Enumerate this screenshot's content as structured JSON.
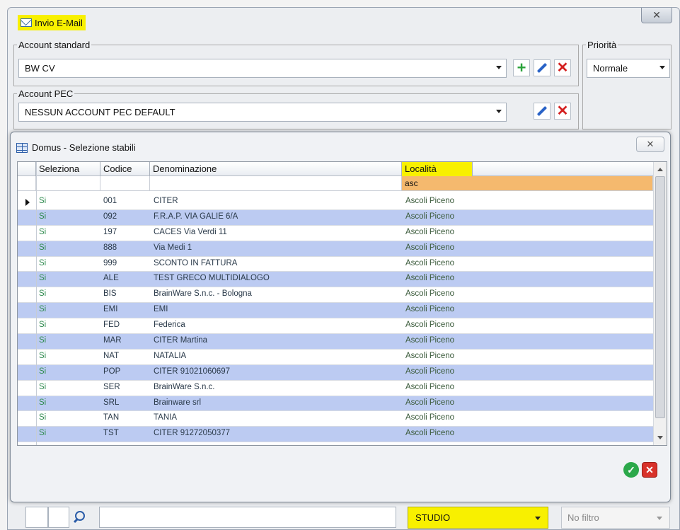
{
  "window": {
    "title": "Invio E-Mail",
    "close": "✕"
  },
  "account_standard": {
    "legend": "Account standard",
    "value": "BW CV"
  },
  "account_pec": {
    "legend": "Account PEC",
    "value": "NESSUN ACCOUNT PEC DEFAULT"
  },
  "priority": {
    "legend": "Priorità",
    "value": "Normale"
  },
  "dialog": {
    "title": "Domus - Selezione stabili",
    "close": "✕",
    "columns": [
      "Seleziona",
      "Codice",
      "Denominazione",
      "Località"
    ],
    "filter_localita": "asc",
    "rows": [
      {
        "sel": "Si",
        "cod": "001",
        "den": "CITER",
        "loc": "Ascoli Piceno"
      },
      {
        "sel": "Si",
        "cod": "092",
        "den": "F.R.A.P. VIA GALIE 6/A",
        "loc": "Ascoli Piceno"
      },
      {
        "sel": "Si",
        "cod": "197",
        "den": "CACES Via Verdi 11",
        "loc": "Ascoli Piceno"
      },
      {
        "sel": "Si",
        "cod": "888",
        "den": "Via Medi 1",
        "loc": "Ascoli Piceno"
      },
      {
        "sel": "Si",
        "cod": "999",
        "den": "SCONTO IN FATTURA",
        "loc": "Ascoli Piceno"
      },
      {
        "sel": "Si",
        "cod": "ALE",
        "den": "TEST GRECO MULTIDIALOGO",
        "loc": "Ascoli Piceno"
      },
      {
        "sel": "Si",
        "cod": "BIS",
        "den": "BrainWare S.n.c. - Bologna",
        "loc": "Ascoli Piceno"
      },
      {
        "sel": "Si",
        "cod": "EMI",
        "den": "EMI",
        "loc": "Ascoli Piceno"
      },
      {
        "sel": "Si",
        "cod": "FED",
        "den": "Federica",
        "loc": "Ascoli Piceno"
      },
      {
        "sel": "Si",
        "cod": "MAR",
        "den": "CITER Martina",
        "loc": "Ascoli Piceno"
      },
      {
        "sel": "Si",
        "cod": "NAT",
        "den": "NATALIA",
        "loc": "Ascoli Piceno"
      },
      {
        "sel": "Si",
        "cod": "POP",
        "den": "CITER 91021060697",
        "loc": "Ascoli Piceno"
      },
      {
        "sel": "Si",
        "cod": "SER",
        "den": "BrainWare S.n.c.",
        "loc": "Ascoli Piceno"
      },
      {
        "sel": "Si",
        "cod": "SRL",
        "den": "Brainware srl",
        "loc": "Ascoli Piceno"
      },
      {
        "sel": "Si",
        "cod": "TAN",
        "den": "TANIA",
        "loc": "Ascoli Piceno"
      },
      {
        "sel": "Si",
        "cod": "TST",
        "den": "CITER 91272050377",
        "loc": "Ascoli Piceno"
      }
    ]
  },
  "bottom": {
    "studio": "STUDIO",
    "filter": "No filtro"
  },
  "colors": {
    "highlight": "#f8f000",
    "row_alt": "#bccbf2",
    "filter_row": "#f5b96e"
  }
}
